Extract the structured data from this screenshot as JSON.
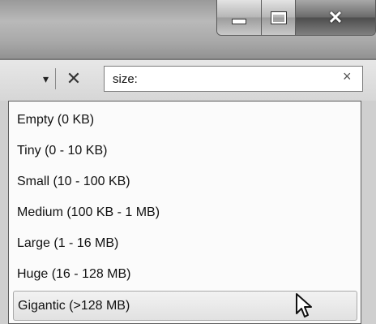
{
  "window": {
    "buttons": {
      "minimize_icon": "minimize-icon",
      "maximize_icon": "maximize-icon",
      "close_icon": "close-icon",
      "close_glyph": "✕"
    }
  },
  "toolbar": {
    "dropdown_glyph": "▾",
    "clear_glyph": "✕"
  },
  "search": {
    "value": "size:",
    "clear_glyph": "×"
  },
  "dropdown": {
    "items": [
      {
        "label": "Empty (0 KB)"
      },
      {
        "label": "Tiny (0 - 10 KB)"
      },
      {
        "label": "Small (10 - 100 KB)"
      },
      {
        "label": "Medium (100 KB - 1 MB)"
      },
      {
        "label": "Large (1 - 16 MB)"
      },
      {
        "label": "Huge (16 - 128 MB)"
      },
      {
        "label": "Gigantic (>128 MB)",
        "hovered": true
      }
    ]
  }
}
